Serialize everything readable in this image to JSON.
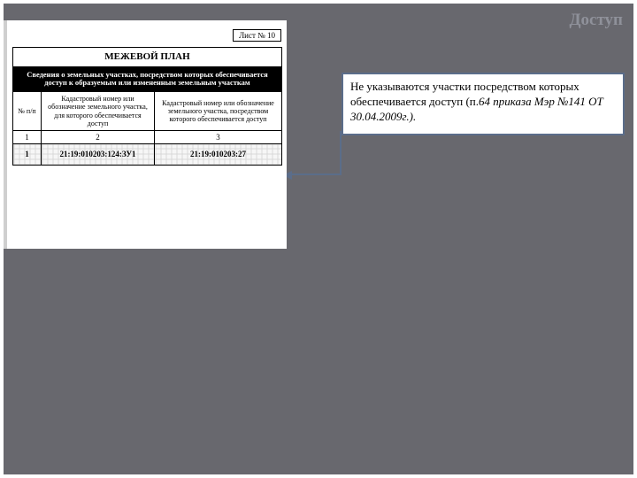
{
  "heading": "Доступ",
  "annotation": {
    "regular": "Не указываются участки посредством которых обеспечивается доступ (п.",
    "italic": "64 приказа  Мэр №141 ОТ 30.04.2009г.)."
  },
  "document": {
    "sheet_label": "Лист № 10",
    "title": "МЕЖЕВОЙ ПЛАН",
    "subtitle": "Сведения о земельных участках, посредством которых обеспечивается доступ к образуемым или измененным земельным участкам",
    "headers": {
      "col1": "№ п/п",
      "col2": "Кадастровый номер или обозначение земельного участка, для которого обеспечивается доступ",
      "col3": "Кадастровый номер или обозначение земельного участка, посредством которого обеспечивается доступ"
    },
    "num_row": {
      "c1": "1",
      "c2": "2",
      "c3": "3"
    },
    "data_row": {
      "c1": "1",
      "c2": "21:19:010203:124:ЗУ1",
      "c3": "21:19:010203:27"
    }
  }
}
